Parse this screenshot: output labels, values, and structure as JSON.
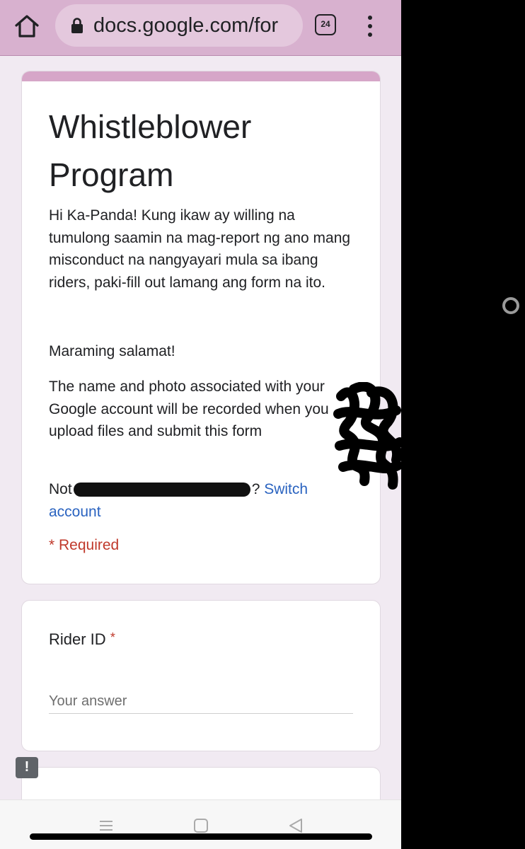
{
  "browser": {
    "url": "docs.google.com/for",
    "tab_count": "24"
  },
  "form": {
    "title": "Whistleblower Program",
    "description": "Hi Ka-Panda! Kung ikaw ay willing na tumulong saamin na mag-report ng ano mang misconduct na nangyayari mula sa ibang riders, paki-fill out lamang ang form na ito.",
    "thanks": "Maraming salamat!",
    "account_notice": "The name and photo associated with your Google account will be recorded when you upload files and submit this form",
    "not_prefix": "Not",
    "not_suffix": "?",
    "switch_account_label": "Switch account",
    "required_note": "* Required",
    "accent_color": "#d6a6c8"
  },
  "questions": [
    {
      "label": "Rider ID",
      "required_mark": "*",
      "placeholder": "Your answer"
    }
  ],
  "feedback_icon_text": "!",
  "icons": {
    "home": "home-icon",
    "lock": "lock-icon",
    "tabs": "tabs-icon",
    "menu": "more-vert-icon",
    "feedback": "feedback-icon",
    "nav_recents": "recents-icon",
    "nav_home": "nav-home-icon",
    "nav_back": "back-icon"
  }
}
